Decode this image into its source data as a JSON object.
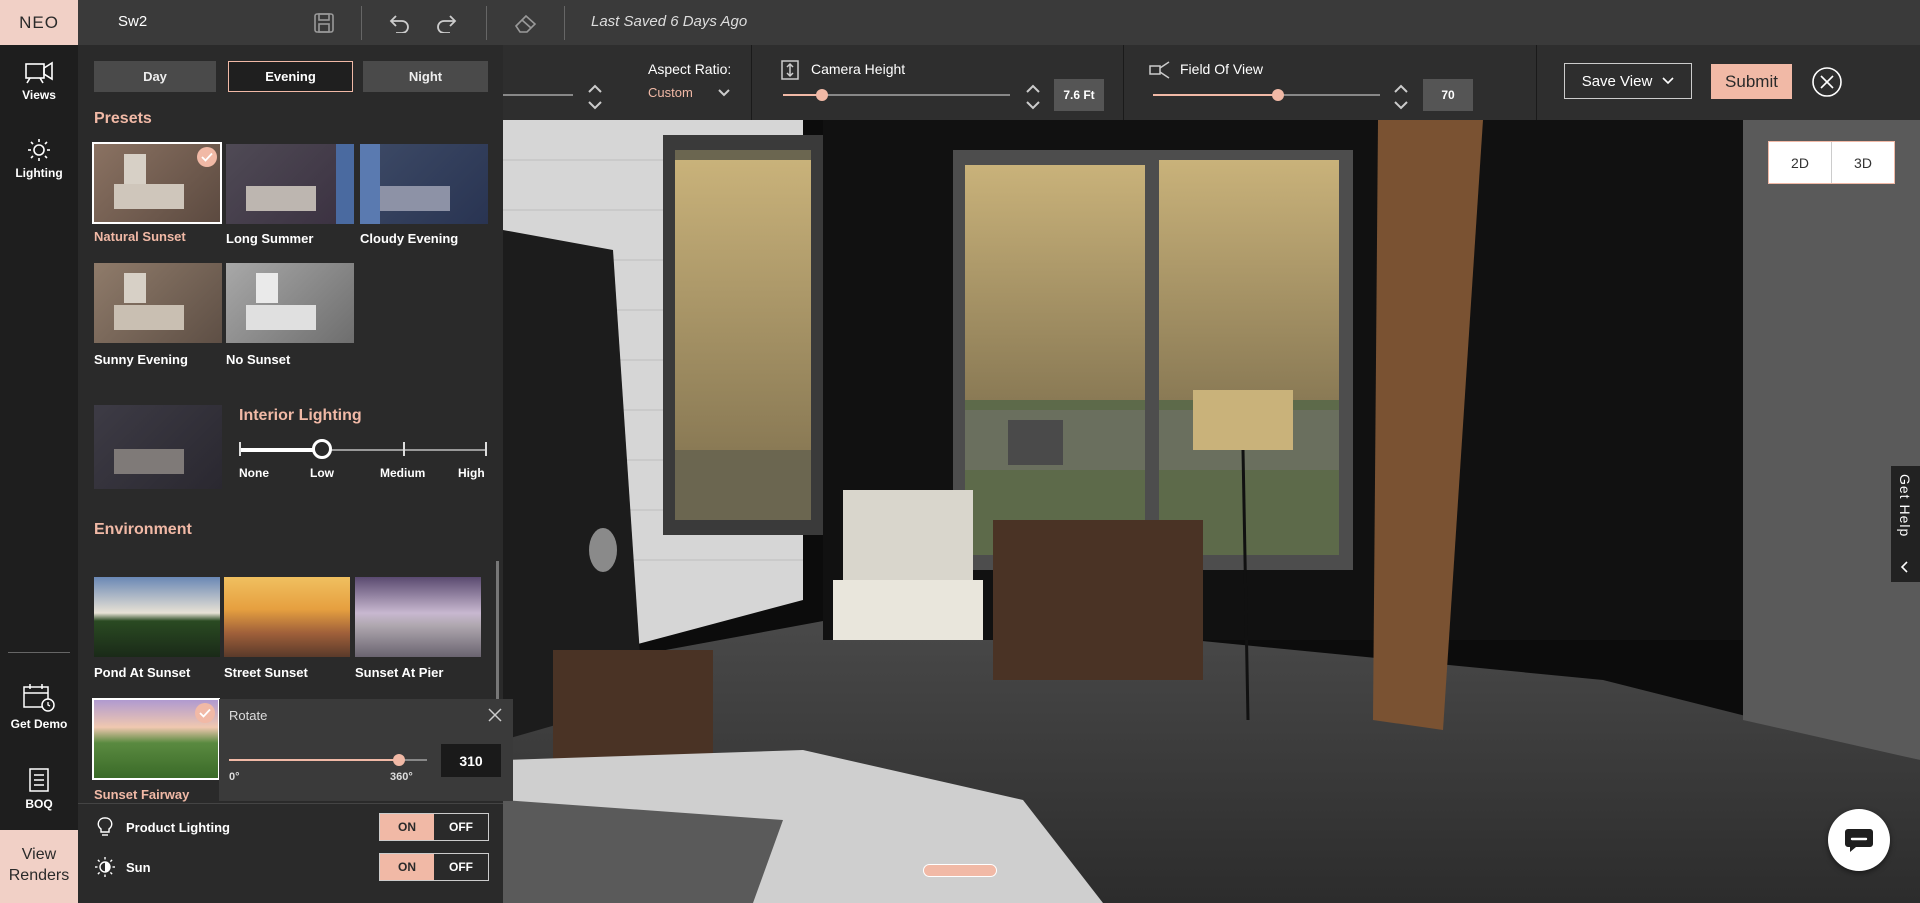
{
  "app": {
    "brand": "NEO",
    "project_name": "Sw2",
    "saved_status": "Last Saved 6 Days Ago"
  },
  "leftrail": {
    "views_label": "Views",
    "lighting_label": "Lighting",
    "get_demo_label": "Get Demo",
    "boq_label": "BOQ",
    "view_renders_line1": "View",
    "view_renders_line2": "Renders"
  },
  "camera": {
    "aspect_label": "Aspect Ratio:",
    "aspect_value": "Custom",
    "height_label": "Camera Height",
    "height_value": "7.6 Ft",
    "height_level": 0.17,
    "fov_label": "Field Of View",
    "fov_value": "70",
    "fov_level": 0.55,
    "save_view_label": "Save View",
    "submit_label": "Submit"
  },
  "view_toggle": {
    "two_d": "2D",
    "three_d": "3D"
  },
  "get_help": "Get Help",
  "lighting": {
    "modes": [
      "Day",
      "Evening",
      "Night"
    ],
    "active_mode": "Evening",
    "presets_title": "Presets",
    "presets": [
      {
        "label": "Natural Sunset",
        "selected": true
      },
      {
        "label": "Long Summer",
        "selected": false
      },
      {
        "label": "Cloudy Evening",
        "selected": false
      },
      {
        "label": "Sunny Evening",
        "selected": false
      },
      {
        "label": "No Sunset",
        "selected": false
      }
    ],
    "interior_title": "Interior Lighting",
    "interior_levels": [
      "None",
      "Low",
      "Medium",
      "High"
    ],
    "interior_level": "Low",
    "environment_title": "Environment",
    "environments": [
      {
        "label": "Pond At Sunset",
        "selected": false
      },
      {
        "label": "Street Sunset",
        "selected": false
      },
      {
        "label": "Sunset At Pier",
        "selected": false
      },
      {
        "label": "Sunset Fairway",
        "selected": true
      }
    ],
    "rotate": {
      "title": "Rotate",
      "min": "0°",
      "max": "360°",
      "value": "310",
      "fraction": 0.86
    },
    "product_lighting": {
      "label": "Product Lighting",
      "on": "ON",
      "off": "OFF",
      "state": "ON"
    },
    "sun": {
      "label": "Sun",
      "on": "ON",
      "off": "OFF",
      "state": "ON"
    }
  },
  "colors": {
    "accent": "#f1b9a6",
    "brand_bg": "#f1d0c6",
    "panel_bg": "#2a2a2a",
    "topbar_bg": "#3a3a3a"
  }
}
